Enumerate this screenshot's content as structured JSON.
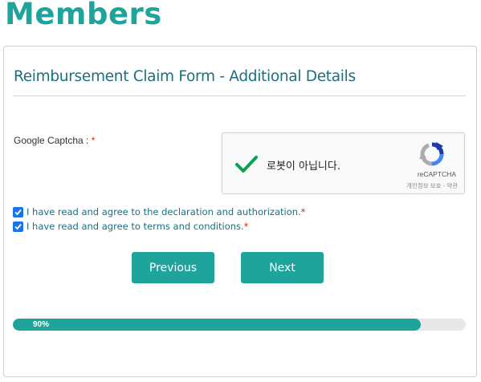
{
  "page": {
    "title": "Members"
  },
  "form": {
    "title": "Reimbursement Claim Form - Additional Details",
    "captcha_label": "Google Captcha : ",
    "required_mark": "*"
  },
  "recaptcha": {
    "status_text": "로봇이 아닙니다.",
    "brand": "reCAPTCHA",
    "links": "개인정보 보호 - 약관",
    "verified": true
  },
  "agreements": [
    {
      "label": "I have read and agree to the declaration and authorization.",
      "required_mark": "*",
      "checked": true
    },
    {
      "label": "I have read and agree to terms and conditions.",
      "required_mark": "*",
      "checked": true
    }
  ],
  "buttons": {
    "previous": "Previous",
    "next": "Next"
  },
  "progress": {
    "percent": 90,
    "label": "90%"
  },
  "colors": {
    "accent": "#1fa49c",
    "title": "#1c6f7d",
    "required": "#d9230f",
    "checkbox": "#1a73e8"
  }
}
